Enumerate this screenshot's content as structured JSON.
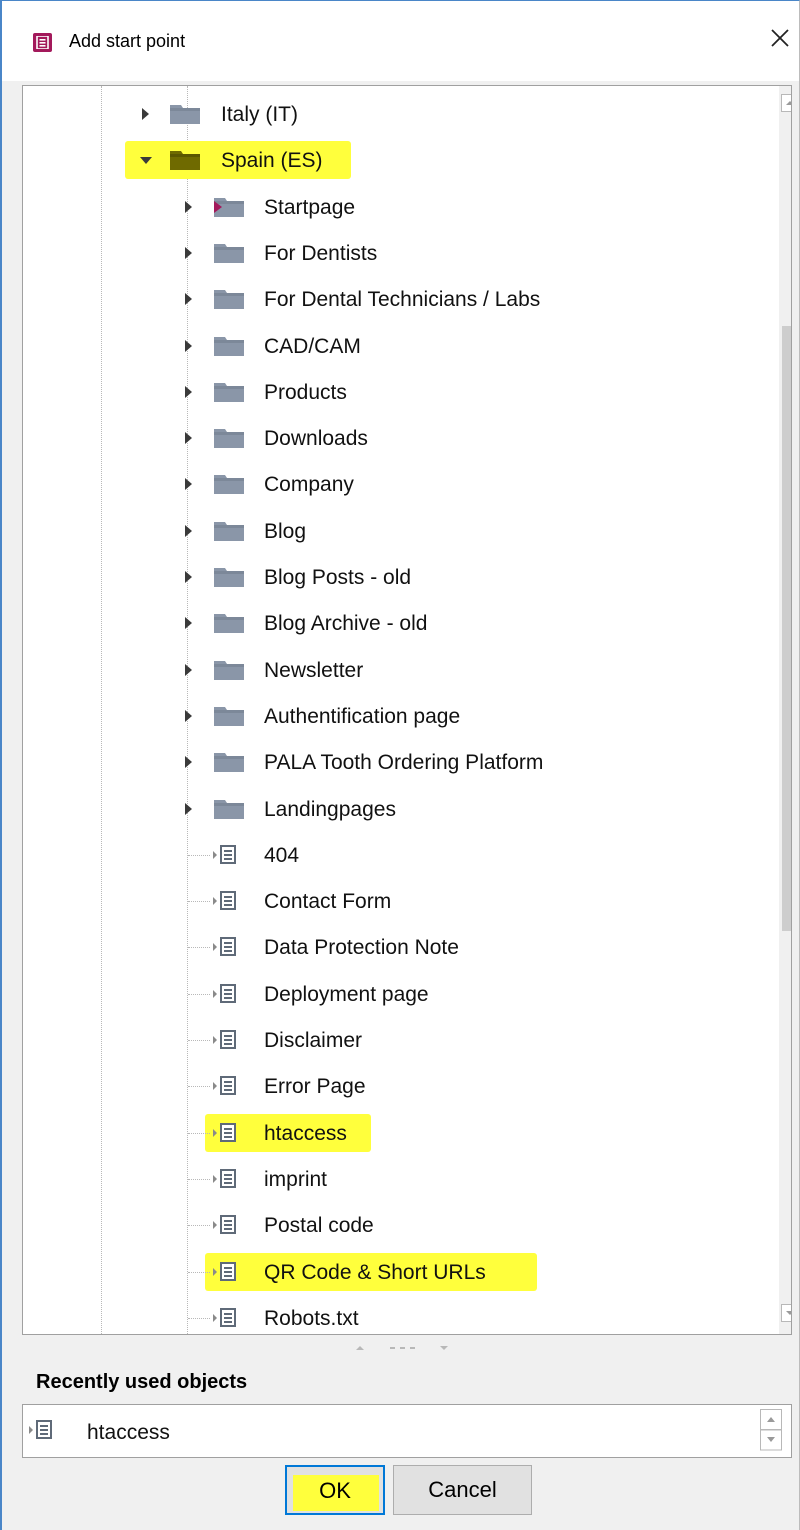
{
  "dialog": {
    "title": "Add start point",
    "icon": "document-app-icon",
    "close_icon": "close-icon"
  },
  "tree": {
    "items": [
      {
        "label": "Italy (IT)",
        "kind": "folder",
        "level": 1,
        "expanded": false,
        "highlighted": false
      },
      {
        "label": "Spain (ES)",
        "kind": "folder",
        "level": 1,
        "expanded": true,
        "highlighted": true
      },
      {
        "label": "Startpage",
        "kind": "folder-start",
        "level": 2,
        "expanded": false,
        "highlighted": false
      },
      {
        "label": "For Dentists",
        "kind": "folder",
        "level": 2,
        "expanded": false,
        "highlighted": false
      },
      {
        "label": "For Dental Technicians / Labs",
        "kind": "folder",
        "level": 2,
        "expanded": false,
        "highlighted": false
      },
      {
        "label": "CAD/CAM",
        "kind": "folder",
        "level": 2,
        "expanded": false,
        "highlighted": false
      },
      {
        "label": "Products",
        "kind": "folder",
        "level": 2,
        "expanded": false,
        "highlighted": false
      },
      {
        "label": "Downloads",
        "kind": "folder",
        "level": 2,
        "expanded": false,
        "highlighted": false
      },
      {
        "label": "Company",
        "kind": "folder",
        "level": 2,
        "expanded": false,
        "highlighted": false
      },
      {
        "label": "Blog",
        "kind": "folder",
        "level": 2,
        "expanded": false,
        "highlighted": false
      },
      {
        "label": "Blog Posts - old",
        "kind": "folder",
        "level": 2,
        "expanded": false,
        "highlighted": false
      },
      {
        "label": "Blog Archive - old",
        "kind": "folder",
        "level": 2,
        "expanded": false,
        "highlighted": false
      },
      {
        "label": "Newsletter",
        "kind": "folder",
        "level": 2,
        "expanded": false,
        "highlighted": false
      },
      {
        "label": "Authentification page",
        "kind": "folder",
        "level": 2,
        "expanded": false,
        "highlighted": false
      },
      {
        "label": "PALA Tooth Ordering Platform",
        "kind": "folder",
        "level": 2,
        "expanded": false,
        "highlighted": false
      },
      {
        "label": "Landingpages",
        "kind": "folder",
        "level": 2,
        "expanded": false,
        "highlighted": false
      },
      {
        "label": "404",
        "kind": "page",
        "level": 2,
        "highlighted": false
      },
      {
        "label": "Contact Form",
        "kind": "page",
        "level": 2,
        "highlighted": false
      },
      {
        "label": "Data Protection Note",
        "kind": "page",
        "level": 2,
        "highlighted": false
      },
      {
        "label": "Deployment page",
        "kind": "page",
        "level": 2,
        "highlighted": false
      },
      {
        "label": "Disclaimer",
        "kind": "page",
        "level": 2,
        "highlighted": false
      },
      {
        "label": "Error Page",
        "kind": "page",
        "level": 2,
        "highlighted": false
      },
      {
        "label": "htaccess",
        "kind": "page",
        "level": 2,
        "highlighted": true
      },
      {
        "label": "imprint",
        "kind": "page",
        "level": 2,
        "highlighted": false
      },
      {
        "label": "Postal code",
        "kind": "page",
        "level": 2,
        "highlighted": false
      },
      {
        "label": "QR Code & Short URLs",
        "kind": "page",
        "level": 2,
        "highlighted": true
      },
      {
        "label": "Robots.txt",
        "kind": "page",
        "level": 2,
        "highlighted": false
      }
    ]
  },
  "recent": {
    "title": "Recently used objects",
    "items": [
      {
        "label": "htaccess",
        "kind": "page"
      }
    ]
  },
  "buttons": {
    "ok": "OK",
    "cancel": "Cancel"
  },
  "colors": {
    "highlight": "#ffff3c",
    "folder": "#8a96a8",
    "folder_highlight": "#6f6a00",
    "app_icon": "#a3195b",
    "focus_border": "#0078d7"
  }
}
